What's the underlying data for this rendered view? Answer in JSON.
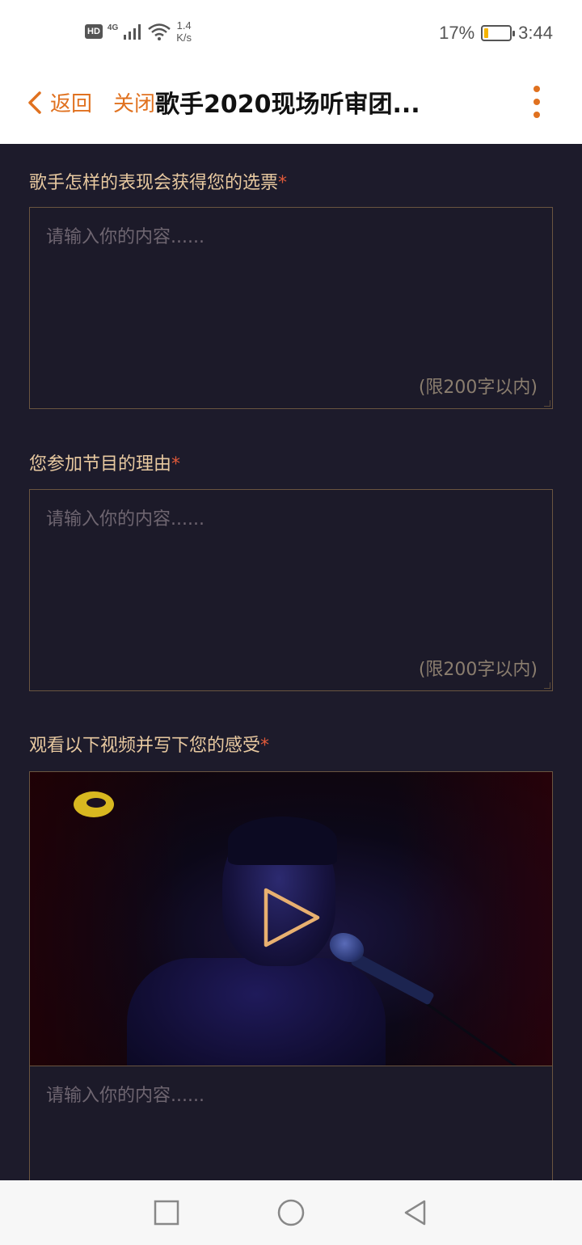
{
  "status_bar": {
    "hd": "HD",
    "network": "4G",
    "speed_value": "1.4",
    "speed_unit": "K/s",
    "battery_percent": "17%",
    "battery_level": 0.17,
    "time": "3:44"
  },
  "nav": {
    "back_label": "返回",
    "close_label": "关闭",
    "title": "歌手2020现场听审团..."
  },
  "form": {
    "questions": [
      {
        "label": "歌手怎样的表现会获得您的选票",
        "required": "*",
        "placeholder": "请输入你的内容......",
        "limit": "(限200字以内)"
      },
      {
        "label": "您参加节目的理由",
        "required": "*",
        "placeholder": "请输入你的内容......",
        "limit": "(限200字以内)"
      },
      {
        "label": "观看以下视频并写下您的感受",
        "required": "*",
        "placeholder": "请输入你的内容......"
      }
    ]
  },
  "colors": {
    "accent": "#e0711f",
    "label": "#e8c9a0",
    "required": "#e05a3a",
    "background": "#1d1b2b"
  }
}
